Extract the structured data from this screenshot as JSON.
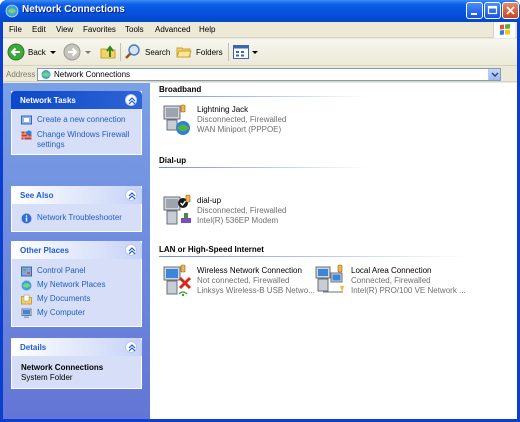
{
  "window": {
    "title": "Network Connections"
  },
  "menu": [
    "File",
    "Edit",
    "View",
    "Favorites",
    "Tools",
    "Advanced",
    "Help"
  ],
  "toolbar": {
    "back_label": "Back",
    "search_label": "Search",
    "folders_label": "Folders"
  },
  "address": {
    "label": "Address",
    "value": "Network Connections"
  },
  "taskpane": {
    "network_tasks": {
      "title": "Network Tasks",
      "items": [
        "Create a new connection",
        "Change Windows Firewall settings"
      ]
    },
    "see_also": {
      "title": "See Also",
      "items": [
        "Network Troubleshooter"
      ]
    },
    "other_places": {
      "title": "Other Places",
      "items": [
        "Control Panel",
        "My Network Places",
        "My Documents",
        "My Computer"
      ]
    },
    "details": {
      "title": "Details",
      "name": "Network Connections",
      "type": "System Folder"
    }
  },
  "groups": {
    "broadband": {
      "title": "Broadband",
      "items": [
        {
          "name": "Lightning Jack",
          "status": "Disconnected, Firewalled",
          "device": "WAN Miniport (PPPOE)"
        }
      ]
    },
    "dialup": {
      "title": "Dial-up",
      "items": [
        {
          "name": "dial-up",
          "status": "Disconnected, Firewalled",
          "device": "Intel(R) 536EP Modem"
        }
      ]
    },
    "lan": {
      "title": "LAN or High-Speed Internet",
      "items": [
        {
          "name": "Wireless Network Connection",
          "status": "Not connected, Firewalled",
          "device": "Linksys Wireless-B USB Netwo..."
        },
        {
          "name": "Local Area Connection",
          "status": "Connected, Firewalled",
          "device": "Intel(R) PRO/100 VE Network ..."
        }
      ]
    }
  },
  "colors": {
    "titlebar": "#0652dc",
    "task_link": "#215dc6",
    "taskpane_bg": "#6f8fdf"
  }
}
